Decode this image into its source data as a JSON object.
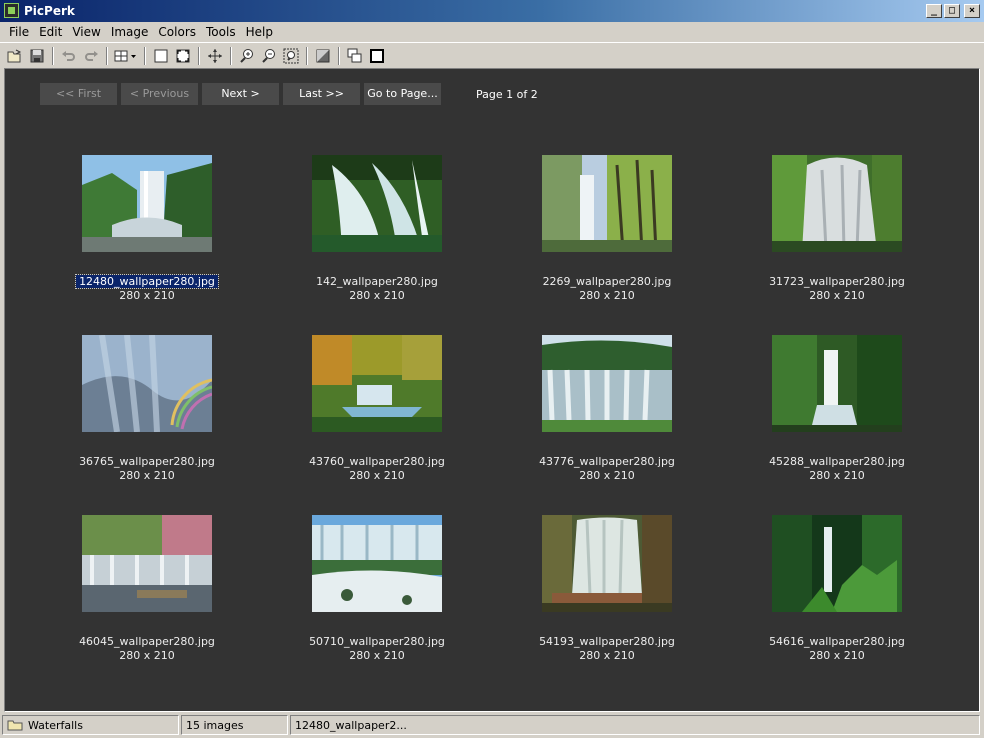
{
  "window": {
    "title": "PicPerk"
  },
  "menu": [
    "File",
    "Edit",
    "View",
    "Image",
    "Colors",
    "Tools",
    "Help"
  ],
  "navigation": {
    "first": "<< First",
    "previous": "< Previous",
    "next": "Next >",
    "last": "Last >>",
    "goto": "Go to Page...",
    "page_label": "Page 1 of 2"
  },
  "thumbnails": [
    {
      "name": "12480_wallpaper280.jpg",
      "dims": "280 x 210",
      "selected": true
    },
    {
      "name": "142_wallpaper280.jpg",
      "dims": "280 x 210"
    },
    {
      "name": "2269_wallpaper280.jpg",
      "dims": "280 x 210"
    },
    {
      "name": "31723_wallpaper280.jpg",
      "dims": "280 x 210"
    },
    {
      "name": "36765_wallpaper280.jpg",
      "dims": "280 x 210"
    },
    {
      "name": "43760_wallpaper280.jpg",
      "dims": "280 x 210"
    },
    {
      "name": "43776_wallpaper280.jpg",
      "dims": "280 x 210"
    },
    {
      "name": "45288_wallpaper280.jpg",
      "dims": "280 x 210"
    },
    {
      "name": "46045_wallpaper280.jpg",
      "dims": "280 x 210"
    },
    {
      "name": "50710_wallpaper280.jpg",
      "dims": "280 x 210"
    },
    {
      "name": "54193_wallpaper280.jpg",
      "dims": "280 x 210"
    },
    {
      "name": "54616_wallpaper280.jpg",
      "dims": "280 x 210"
    }
  ],
  "status": {
    "folder": "Waterfalls",
    "count": "15 images",
    "current": "12480_wallpaper2..."
  },
  "colors": {
    "content_bg": "#333333",
    "selection": "#0a246a",
    "chrome": "#d4d0c8"
  }
}
